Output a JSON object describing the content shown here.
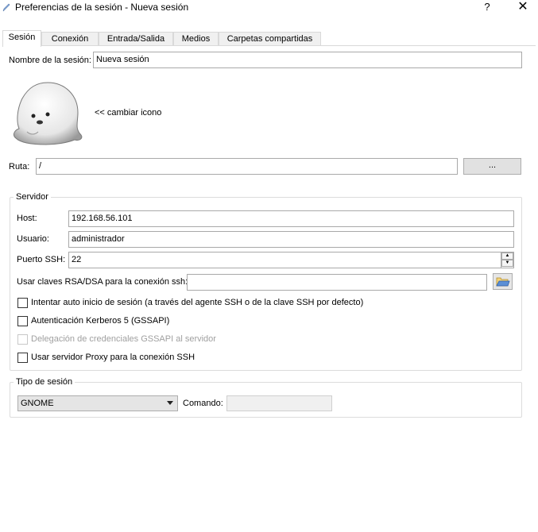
{
  "window": {
    "title": "Preferencias de la sesión - Nueva sesión",
    "help_label": "?",
    "close_label": "✕"
  },
  "tabs": [
    {
      "label": "Sesión",
      "active": true
    },
    {
      "label": "Conexión",
      "active": false
    },
    {
      "label": "Entrada/Salida",
      "active": false
    },
    {
      "label": "Medios",
      "active": false
    },
    {
      "label": "Carpetas compartidas",
      "active": false
    }
  ],
  "session": {
    "name_label": "Nombre de la sesión:",
    "name_value": "Nueva sesión",
    "change_icon_label": "<< cambiar icono",
    "path_label": "Ruta:",
    "path_value": "/",
    "browse_label": "..."
  },
  "server": {
    "group_title": "Servidor",
    "host_label": "Host:",
    "host_value": "192.168.56.101",
    "user_label": "Usuario:",
    "user_value": "administrador",
    "port_label": "Puerto SSH:",
    "port_value": "22",
    "keys_label": "Usar claves RSA/DSA para la conexión ssh:",
    "keys_value": "",
    "options": [
      {
        "label": "Intentar auto inicio de sesión (a través del agente SSH o de la clave SSH por defecto)",
        "checked": false,
        "disabled": false
      },
      {
        "label": "Autenticación Kerberos 5 (GSSAPI)",
        "checked": false,
        "disabled": false
      },
      {
        "label": "Delegación de credenciales GSSAPI al servidor",
        "checked": false,
        "disabled": true
      },
      {
        "label": "Usar servidor Proxy para la conexión SSH",
        "checked": false,
        "disabled": false
      }
    ]
  },
  "session_type": {
    "group_title": "Tipo de sesión",
    "selected": "GNOME",
    "command_label": "Comando:",
    "command_value": ""
  },
  "colors": {
    "tab_border": "#d9d9d9",
    "field_border": "#a9a9a9",
    "button_bg": "#e1e1e1",
    "disabled_text": "#a0a0a0"
  },
  "icons": [
    "app-icon",
    "seal-icon",
    "folder-open-icon",
    "spin-up-icon",
    "spin-down-icon",
    "dropdown-arrow-icon"
  ]
}
